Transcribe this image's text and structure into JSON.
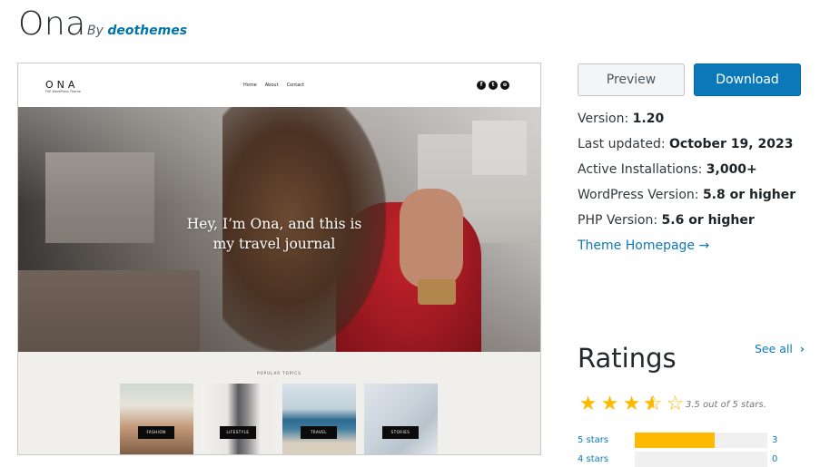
{
  "theme": {
    "name": "Ona",
    "by_label": "By",
    "author": "deothemes"
  },
  "screenshot": {
    "brand": "ONA",
    "brand_sub": "FSE WordPress Theme",
    "nav": [
      "Home",
      "About",
      "Contact"
    ],
    "social": [
      "f",
      "t",
      "o"
    ],
    "hero_text_line1": "Hey, I’m Ona, and this is",
    "hero_text_line2": "my travel journal",
    "topics_label": "POPULAR TOPICS",
    "topics": [
      "FASHION",
      "LIFESTYLE",
      "TRAVEL",
      "STORIES"
    ]
  },
  "actions": {
    "preview": "Preview",
    "download": "Download"
  },
  "meta": {
    "version_label": "Version:",
    "version": "1.20",
    "updated_label": "Last updated:",
    "updated": "October 19, 2023",
    "installs_label": "Active Installations:",
    "installs": "3,000+",
    "wp_label": "WordPress Version:",
    "wp": "5.8 or higher",
    "php_label": "PHP Version:",
    "php": "5.6 or higher",
    "homepage": "Theme Homepage →"
  },
  "ratings": {
    "title": "Ratings",
    "see_all": "See all",
    "chevron": "›",
    "value": 3.5,
    "summary": "3.5 out of 5 stars.",
    "star_color": "#ffb900",
    "rows": [
      {
        "label": "5 stars",
        "count": "3",
        "fraction": 0.6
      },
      {
        "label": "4 stars",
        "count": "0",
        "fraction": 0
      }
    ]
  },
  "colors": {
    "link": "#0b79b8",
    "download_bg": "#0b79b8"
  }
}
